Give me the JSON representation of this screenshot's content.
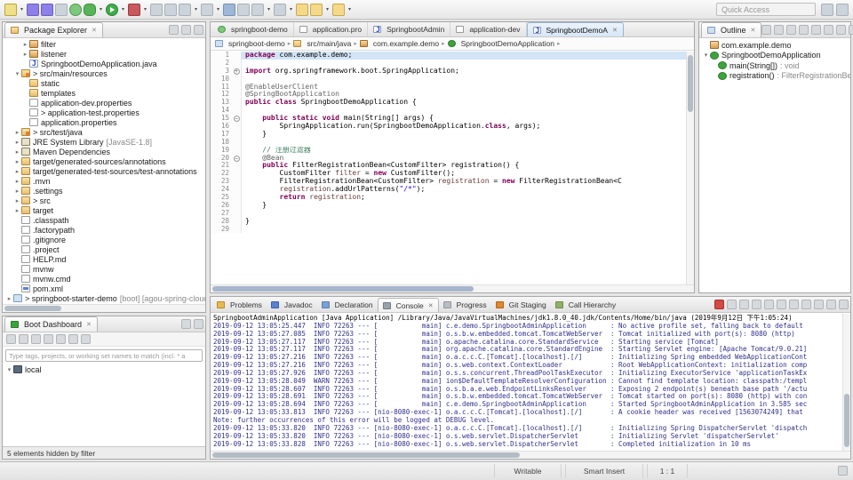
{
  "window": {
    "quick_access_placeholder": "Quick Access"
  },
  "main_toolbar": {
    "icons": [
      {
        "name": "new-wizard",
        "caret": true
      },
      {
        "name": "save"
      },
      {
        "name": "save-all"
      },
      {
        "name": "print"
      },
      {
        "name": "spring-boot"
      },
      {
        "name": "debug",
        "caret": true
      },
      {
        "name": "run",
        "caret": true
      },
      {
        "name": "coverage",
        "caret": true
      },
      {
        "name": "new-java-project"
      },
      {
        "name": "new-package"
      },
      {
        "name": "new-class",
        "caret": true
      },
      {
        "name": "open-task",
        "caret": true
      },
      {
        "name": "search"
      },
      {
        "name": "open-type"
      },
      {
        "name": "annotation-next",
        "caret": true
      },
      {
        "name": "annotation-prev",
        "caret": true
      },
      {
        "name": "last-edit-location"
      },
      {
        "name": "back",
        "caret": true
      },
      {
        "name": "forward",
        "caret": true
      }
    ],
    "perspective_icons": [
      "open-perspective",
      "java-perspective"
    ]
  },
  "package_explorer": {
    "title": "Package Explorer",
    "icon": "view-folder",
    "header_icons": [
      "view-menu",
      "minimize",
      "maximize"
    ],
    "items": [
      {
        "arrow": "right",
        "icon": "package",
        "label": "filter",
        "depth": 2
      },
      {
        "arrow": "right",
        "icon": "package",
        "label": "listener",
        "depth": 2
      },
      {
        "arrow": "",
        "icon": "java",
        "label": "SpringbootDemoApplication.java",
        "depth": 2
      },
      {
        "arrow": "down",
        "icon": "srcfolder",
        "label": "> src/main/resources",
        "depth": 1
      },
      {
        "arrow": "",
        "icon": "folder",
        "label": "static",
        "depth": 2
      },
      {
        "arrow": "",
        "icon": "folder",
        "label": "templates",
        "depth": 2
      },
      {
        "arrow": "",
        "icon": "file",
        "label": "application-dev.properties",
        "depth": 2
      },
      {
        "arrow": "",
        "icon": "file",
        "label": "> application-test.properties",
        "depth": 2
      },
      {
        "arrow": "",
        "icon": "file",
        "label": "application.properties",
        "depth": 2
      },
      {
        "arrow": "right",
        "icon": "srcfolder",
        "label": "> src/test/java",
        "depth": 1
      },
      {
        "arrow": "right",
        "icon": "library",
        "label": "JRE System Library",
        "deco": "[JavaSE-1.8]",
        "depth": 1
      },
      {
        "arrow": "right",
        "icon": "library",
        "label": "Maven Dependencies",
        "depth": 1
      },
      {
        "arrow": "right",
        "icon": "folder",
        "label": "target/generated-sources/annotations",
        "depth": 1
      },
      {
        "arrow": "right",
        "icon": "folder",
        "label": "target/generated-test-sources/test-annotations",
        "depth": 1
      },
      {
        "arrow": "right",
        "icon": "folder",
        "label": ".mvn",
        "depth": 1
      },
      {
        "arrow": "right",
        "icon": "folder",
        "label": ".settings",
        "depth": 1
      },
      {
        "arrow": "right",
        "icon": "folder",
        "label": "> src",
        "depth": 1
      },
      {
        "arrow": "right",
        "icon": "folder",
        "label": "target",
        "depth": 1
      },
      {
        "arrow": "",
        "icon": "file",
        "label": ".classpath",
        "depth": 1
      },
      {
        "arrow": "",
        "icon": "file",
        "label": ".factorypath",
        "depth": 1
      },
      {
        "arrow": "",
        "icon": "file",
        "label": ".gitignore",
        "depth": 1
      },
      {
        "arrow": "",
        "icon": "file",
        "label": ".project",
        "depth": 1
      },
      {
        "arrow": "",
        "icon": "file",
        "label": "HELP.md",
        "depth": 1
      },
      {
        "arrow": "",
        "icon": "file",
        "label": "mvnw",
        "depth": 1
      },
      {
        "arrow": "",
        "icon": "file",
        "label": "mvnw.cmd",
        "depth": 1
      },
      {
        "arrow": "",
        "icon": "xml",
        "label": "pom.xml",
        "depth": 1
      },
      {
        "arrow": "right",
        "icon": "project",
        "label": "> springboot-starter-demo",
        "deco": "[boot] [agou-spring-cloud ma",
        "depth": 0
      }
    ]
  },
  "editor": {
    "tabs": [
      {
        "label": "springboot-demo",
        "icon": "spring"
      },
      {
        "label": "application.pro",
        "icon": "file"
      },
      {
        "label": "SpringbootAdmin",
        "icon": "java"
      },
      {
        "label": "application-dev",
        "icon": "file"
      },
      {
        "label": "SpringbootDemoA",
        "icon": "java",
        "active": true
      }
    ],
    "breadcrumb": [
      {
        "icon": "project",
        "label": "springboot-demo"
      },
      {
        "icon": "folder",
        "label": "src/main/java"
      },
      {
        "icon": "package",
        "label": "com.example.demo"
      },
      {
        "icon": "class",
        "label": "SpringbootDemoApplication"
      }
    ],
    "lines": [
      {
        "n": "1",
        "hl": true,
        "tokens": [
          {
            "t": "package ",
            "c": "kw"
          },
          {
            "t": "com.example.demo;",
            "c": "pl"
          }
        ]
      },
      {
        "n": "2",
        "tokens": []
      },
      {
        "n": "3",
        "fold": "plus",
        "tokens": [
          {
            "t": "import ",
            "c": "kw"
          },
          {
            "t": "org.springframework.boot.SpringApplication;",
            "c": "pl"
          }
        ]
      },
      {
        "n": "10",
        "tokens": []
      },
      {
        "n": "11",
        "tokens": [
          {
            "t": "@EnableUserClient",
            "c": "ann"
          }
        ]
      },
      {
        "n": "12",
        "tokens": [
          {
            "t": "@SpringBootApplication",
            "c": "ann"
          }
        ]
      },
      {
        "n": "13",
        "tokens": [
          {
            "t": "public class ",
            "c": "kw"
          },
          {
            "t": "SpringbootDemoApplication {",
            "c": "pl"
          }
        ]
      },
      {
        "n": "14",
        "tokens": []
      },
      {
        "n": "15",
        "fold": "minus",
        "tokens": [
          {
            "t": "    ",
            "c": "pl"
          },
          {
            "t": "public static void ",
            "c": "kw"
          },
          {
            "t": "main(String[] args) {",
            "c": "pl"
          }
        ]
      },
      {
        "n": "16",
        "tokens": [
          {
            "t": "        SpringApplication.run(SpringbootDemoApplication.",
            "c": "pl"
          },
          {
            "t": "class",
            "c": "kw"
          },
          {
            "t": ", args);",
            "c": "pl"
          }
        ]
      },
      {
        "n": "17",
        "tokens": [
          {
            "t": "    }",
            "c": "pl"
          }
        ]
      },
      {
        "n": "18",
        "tokens": []
      },
      {
        "n": "19",
        "tokens": [
          {
            "t": "    ",
            "c": "pl"
          },
          {
            "t": "// 注册过滤器",
            "c": "com"
          }
        ]
      },
      {
        "n": "20",
        "fold": "minus",
        "tokens": [
          {
            "t": "    ",
            "c": "pl"
          },
          {
            "t": "@Bean",
            "c": "ann"
          }
        ]
      },
      {
        "n": "21",
        "tokens": [
          {
            "t": "    ",
            "c": "pl"
          },
          {
            "t": "public ",
            "c": "kw"
          },
          {
            "t": "FilterRegistrationBean<CustomFilter> registration() {",
            "c": "pl"
          }
        ]
      },
      {
        "n": "22",
        "tokens": [
          {
            "t": "        CustomFilter ",
            "c": "pl"
          },
          {
            "t": "filter",
            "c": "var"
          },
          {
            "t": " = ",
            "c": "pl"
          },
          {
            "t": "new ",
            "c": "kw"
          },
          {
            "t": "CustomFilter();",
            "c": "pl"
          }
        ]
      },
      {
        "n": "23",
        "tokens": [
          {
            "t": "        FilterRegistrationBean<CustomFilter> ",
            "c": "pl"
          },
          {
            "t": "registration",
            "c": "var"
          },
          {
            "t": " = ",
            "c": "pl"
          },
          {
            "t": "new ",
            "c": "kw"
          },
          {
            "t": "FilterRegistrationBean<C",
            "c": "pl"
          }
        ]
      },
      {
        "n": "24",
        "tokens": [
          {
            "t": "        ",
            "c": "pl"
          },
          {
            "t": "registration",
            "c": "var"
          },
          {
            "t": ".addUrlPatterns(",
            "c": "pl"
          },
          {
            "t": "\"/*\"",
            "c": "str"
          },
          {
            "t": ");",
            "c": "pl"
          }
        ]
      },
      {
        "n": "25",
        "tokens": [
          {
            "t": "        ",
            "c": "pl"
          },
          {
            "t": "return ",
            "c": "kw"
          },
          {
            "t": "registration",
            "c": "var"
          },
          {
            "t": ";",
            "c": "pl"
          }
        ]
      },
      {
        "n": "26",
        "tokens": [
          {
            "t": "    }",
            "c": "pl"
          }
        ]
      },
      {
        "n": "27",
        "tokens": []
      },
      {
        "n": "28",
        "tokens": [
          {
            "t": "}",
            "c": "pl"
          }
        ]
      },
      {
        "n": "29",
        "tokens": []
      }
    ]
  },
  "outline": {
    "title": "Outline",
    "icon": "outline-view",
    "header_icons": [
      "collapse-all",
      "sort",
      "hide-fields",
      "hide-static",
      "hide-non-public",
      "view-menu",
      "minimize",
      "maximize"
    ],
    "items": [
      {
        "arrow": "",
        "icon": "package",
        "label": "com.example.demo",
        "depth": 0
      },
      {
        "arrow": "down",
        "icon": "class",
        "label": "SpringbootDemoApplication",
        "depth": 0
      },
      {
        "arrow": "",
        "icon": "method",
        "label": "main(String[])",
        "deco": ": void",
        "depth": 1
      },
      {
        "arrow": "",
        "icon": "method",
        "label": "registration()",
        "deco": ": FilterRegistrationBean<",
        "depth": 1
      }
    ]
  },
  "boot_dashboard": {
    "title": "Boot Dashboard",
    "icon": "boot",
    "header_icons": [
      "minimize",
      "maximize"
    ],
    "toolbar_icons": [
      "bd-start",
      "bd-start-debug",
      "bd-stop",
      "bd-restart",
      "bd-open-console",
      "bd-open-browser",
      "bd-menu"
    ],
    "filter_placeholder": "Type tags, projects, or working set names to match (incl. * a",
    "items": [
      {
        "arrow": "down",
        "icon": "monitor",
        "label": "local",
        "depth": 0
      }
    ],
    "footer": "5 elements hidden by filter"
  },
  "console": {
    "tabs": [
      {
        "label": "Problems",
        "icon": "problems"
      },
      {
        "label": "Javadoc",
        "icon": "javadoc"
      },
      {
        "label": "Declaration",
        "icon": "declaration"
      },
      {
        "label": "Console",
        "icon": "console-view",
        "active": true
      },
      {
        "label": "Progress",
        "icon": "progress"
      },
      {
        "label": "Git Staging",
        "icon": "git"
      },
      {
        "label": "Call Hierarchy",
        "icon": "call-hierarchy"
      }
    ],
    "toolbar_icons": [
      "terminate",
      "remove-launch",
      "remove-all-launches",
      "clear-console",
      "scroll-lock",
      "word-wrap",
      "pin-console",
      "display-selected-console",
      "open-console",
      "minimize",
      "maximize"
    ],
    "header": "SpringbootAdminApplication [Java Application] /Library/Java/JavaVirtualMachines/jdk1.8.0_40.jdk/Contents/Home/bin/java (2019年9月12日 下午1:05:24)",
    "lines": [
      "2019-09-12 13:05:25.447  INFO 72263 --- [           main] c.e.demo.SpringbootAdminApplication      : No active profile set, falling back to default",
      "2019-09-12 13:05:27.085  INFO 72263 --- [           main] o.s.b.w.embedded.tomcat.TomcatWebServer  : Tomcat initialized with port(s): 8080 (http)",
      "2019-09-12 13:05:27.117  INFO 72263 --- [           main] o.apache.catalina.core.StandardService   : Starting service [Tomcat]",
      "2019-09-12 13:05:27.117  INFO 72263 --- [           main] org.apache.catalina.core.StandardEngine  : Starting Servlet engine: [Apache Tomcat/9.0.21]",
      "2019-09-12 13:05:27.216  INFO 72263 --- [           main] o.a.c.c.C.[Tomcat].[localhost].[/]       : Initializing Spring embedded WebApplicationCont",
      "2019-09-12 13:05:27.216  INFO 72263 --- [           main] o.s.web.context.ContextLoader            : Root WebApplicationContext: initialization comp",
      "2019-09-12 13:05:27.926  INFO 72263 --- [           main] o.s.s.concurrent.ThreadPoolTaskExecutor  : Initializing ExecutorService 'applicationTaskEx",
      "2019-09-12 13:05:28.049  WARN 72263 --- [           main] ion$DefaultTemplateResolverConfiguration : Cannot find template location: classpath:/templ",
      "2019-09-12 13:05:28.607  INFO 72263 --- [           main] o.s.b.a.e.web.EndpointLinksResolver      : Exposing 2 endpoint(s) beneath base path '/actu",
      "2019-09-12 13:05:28.691  INFO 72263 --- [           main] o.s.b.w.embedded.tomcat.TomcatWebServer  : Tomcat started on port(s): 8080 (http) with con",
      "2019-09-12 13:05:28.694  INFO 72263 --- [           main] c.e.demo.SpringbootAdminApplication      : Started SpringbootAdminApplication in 3.585 sec",
      "2019-09-12 13:05:33.813  INFO 72263 --- [nio-8080-exec-1] o.a.c.c.C.[Tomcat].[localhost].[/]       : A cookie header was received [1563074249] that ",
      "Note: further occurrences of this error will be logged at DEBUG level.",
      "2019-09-12 13:05:33.820  INFO 72263 --- [nio-8080-exec-1] o.a.c.c.C.[Tomcat].[localhost].[/]       : Initializing Spring DispatcherServlet 'dispatch",
      "2019-09-12 13:05:33.820  INFO 72263 --- [nio-8080-exec-1] o.s.web.servlet.DispatcherServlet        : Initializing Servlet 'dispatcherServlet'",
      "2019-09-12 13:05:33.828  INFO 72263 --- [nio-8080-exec-1] o.s.web.servlet.DispatcherServlet        : Completed initialization in 10 ms"
    ]
  },
  "status_bar": {
    "writable": "Writable",
    "insert_mode": "Smart Insert",
    "caret_position": "1 : 1"
  }
}
